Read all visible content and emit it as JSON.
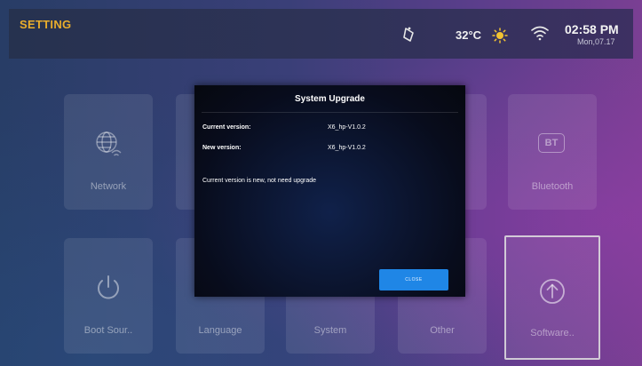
{
  "header": {
    "title": "SETTING",
    "temperature": "32°C",
    "time": "02:58 PM",
    "date": "Mon,07.17",
    "accent_color": "#e9ad2c"
  },
  "tiles": [
    {
      "label": "Network",
      "icon": "globe-wifi-icon"
    },
    {
      "label": "Bluetooth",
      "icon": "bluetooth-icon"
    },
    {
      "label": "Boot Sour..",
      "icon": "power-icon"
    },
    {
      "label": "Language",
      "icon": "language-icon"
    },
    {
      "label": "System",
      "icon": "system-gear-icon"
    },
    {
      "label": "Other",
      "icon": "other-icon"
    },
    {
      "label": "Software..",
      "icon": "upgrade-arrow-icon",
      "selected": true
    }
  ],
  "bluetooth_badge": "BT",
  "dialog": {
    "title": "System Upgrade",
    "current_label": "Current version:",
    "current_value": "X6_hp-V1.0.2",
    "new_label": "New version:",
    "new_value": "X6_hp-V1.0.2",
    "message": "Current version is new, not need upgrade",
    "close_label": "CLOSE",
    "close_color": "#1f86e6"
  }
}
